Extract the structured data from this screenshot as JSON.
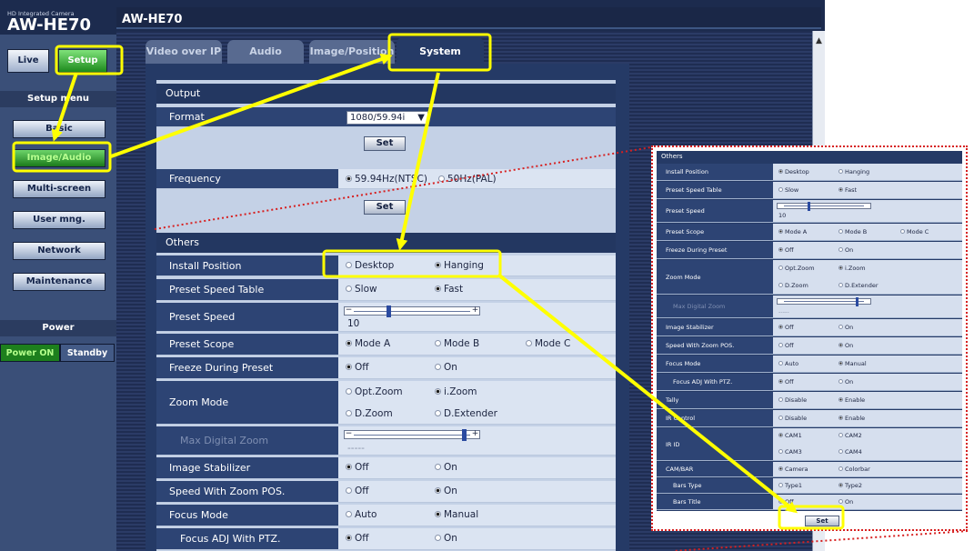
{
  "brand": {
    "sub": "HD Integrated Camera",
    "model": "AW-HE70"
  },
  "header": {
    "title": "AW-HE70"
  },
  "modes": {
    "live": "Live",
    "setup": "Setup"
  },
  "sidebar": {
    "menu_title": "Setup menu",
    "items": [
      {
        "label": "Basic",
        "active": false
      },
      {
        "label": "Image/Audio",
        "active": true
      },
      {
        "label": "Multi-screen",
        "active": false
      },
      {
        "label": "User mng.",
        "active": false
      },
      {
        "label": "Network",
        "active": false
      },
      {
        "label": "Maintenance",
        "active": false
      }
    ],
    "power_title": "Power",
    "power_on": "Power ON",
    "standby": "Standby"
  },
  "tabs": [
    {
      "label": "Video over IP",
      "active": false
    },
    {
      "label": "Audio",
      "active": false
    },
    {
      "label": "Image/Position",
      "active": false
    },
    {
      "label": "System",
      "active": true
    }
  ],
  "output": {
    "section": "Output",
    "format_label": "Format",
    "format_value": "1080/59.94i",
    "set": "Set",
    "frequency_label": "Frequency",
    "frequency_options": [
      "59.94Hz(NTSC)",
      "50Hz(PAL)"
    ],
    "frequency_selected": 0,
    "set2": "Set"
  },
  "others": {
    "section": "Others",
    "install_position": {
      "label": "Install Position",
      "options": [
        "Desktop",
        "Hanging"
      ],
      "selected": 1
    },
    "preset_speed_table": {
      "label": "Preset Speed Table",
      "options": [
        "Slow",
        "Fast"
      ],
      "selected": 1
    },
    "preset_speed": {
      "label": "Preset Speed",
      "value": "10",
      "level": 0.3
    },
    "preset_scope": {
      "label": "Preset Scope",
      "options": [
        "Mode A",
        "Mode B",
        "Mode C"
      ],
      "selected": 0
    },
    "freeze_during_preset": {
      "label": "Freeze During Preset",
      "options": [
        "Off",
        "On"
      ],
      "selected": 0
    },
    "zoom_mode": {
      "label": "Zoom Mode",
      "options": [
        "Opt.Zoom",
        "i.Zoom",
        "D.Zoom",
        "D.Extender"
      ],
      "selected": 1
    },
    "max_digital_zoom": {
      "label": "Max Digital Zoom",
      "value": "-----",
      "level": 0.95
    },
    "image_stabilizer": {
      "label": "Image Stabilizer",
      "options": [
        "Off",
        "On"
      ],
      "selected": 0
    },
    "speed_with_zoom_pos": {
      "label": "Speed With Zoom POS.",
      "options": [
        "Off",
        "On"
      ],
      "selected": 1
    },
    "focus_mode": {
      "label": "Focus Mode",
      "options": [
        "Auto",
        "Manual"
      ],
      "selected": 1
    },
    "focus_adj_with_ptz": {
      "label": "Focus ADJ With PTZ.",
      "options": [
        "Off",
        "On"
      ],
      "selected": 0
    }
  },
  "zoom_panel": {
    "section": "Others",
    "install_position": {
      "label": "Install Position",
      "options": [
        "Desktop",
        "Hanging"
      ],
      "selected": 0
    },
    "preset_speed_table": {
      "label": "Preset Speed Table",
      "options": [
        "Slow",
        "Fast"
      ],
      "selected": 1
    },
    "preset_speed": {
      "label": "Preset Speed",
      "value": "10",
      "level": 0.3
    },
    "preset_scope": {
      "label": "Preset Scope",
      "options": [
        "Mode A",
        "Mode B",
        "Mode C"
      ],
      "selected": 0
    },
    "freeze_during_preset": {
      "label": "Freeze During Preset",
      "options": [
        "Off",
        "On"
      ],
      "selected": 0
    },
    "zoom_mode": {
      "label": "Zoom Mode",
      "options": [
        "Opt.Zoom",
        "i.Zoom",
        "D.Zoom",
        "D.Extender"
      ],
      "selected": 1
    },
    "max_digital_zoom": {
      "label": "Max Digital Zoom",
      "value": "-----",
      "level": 0.95
    },
    "image_stabilizer": {
      "label": "Image Stabilizer",
      "options": [
        "Off",
        "On"
      ],
      "selected": 0
    },
    "speed_with_zoom_pos": {
      "label": "Speed With Zoom POS.",
      "options": [
        "Off",
        "On"
      ],
      "selected": 1
    },
    "focus_mode": {
      "label": "Focus Mode",
      "options": [
        "Auto",
        "Manual"
      ],
      "selected": 1
    },
    "focus_adj_with_ptz": {
      "label": "Focus ADJ With PTZ.",
      "options": [
        "Off",
        "On"
      ],
      "selected": 0
    },
    "tally": {
      "label": "Tally",
      "options": [
        "Disable",
        "Enable"
      ],
      "selected": 1
    },
    "ir_control": {
      "label": "IR Control",
      "options": [
        "Disable",
        "Enable"
      ],
      "selected": 1
    },
    "ir_id": {
      "label": "IR ID",
      "options": [
        "CAM1",
        "CAM2",
        "CAM3",
        "CAM4"
      ],
      "selected": 0
    },
    "cam_bar": {
      "label": "CAM/BAR",
      "options": [
        "Camera",
        "Colorbar"
      ],
      "selected": 0
    },
    "bars_type": {
      "label": "Bars Type",
      "options": [
        "Type1",
        "Type2"
      ],
      "selected": 1
    },
    "bars_title": {
      "label": "Bars Title",
      "options": [
        "Off",
        "On"
      ],
      "selected": 0
    },
    "set": "Set"
  },
  "colors": {
    "highlight": "#ffff00",
    "zoom_border": "#d72020",
    "panel": "#253a66",
    "active_green": "#1d7f1d"
  }
}
